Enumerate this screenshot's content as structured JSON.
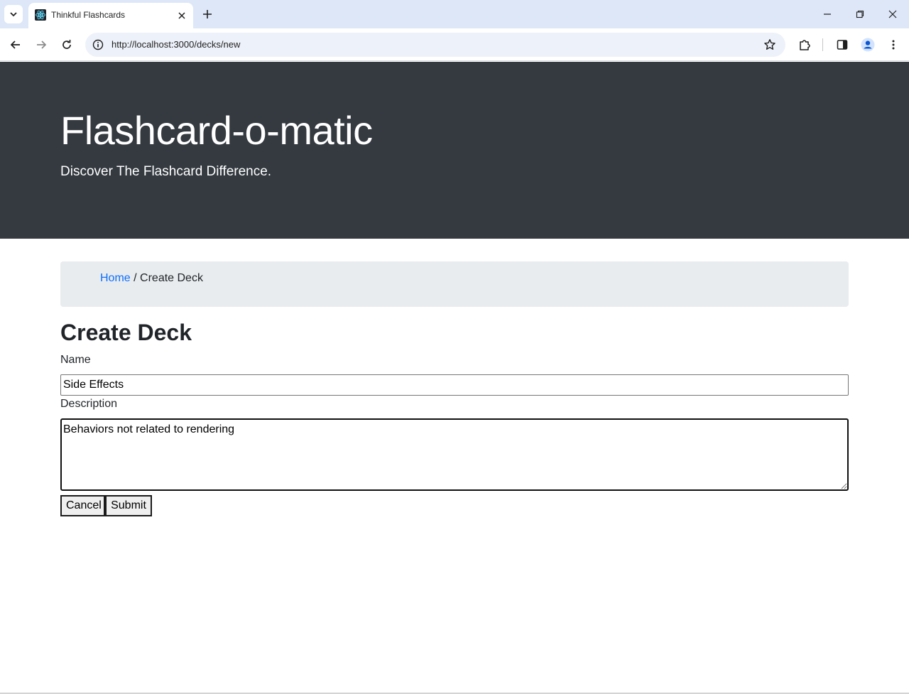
{
  "browser": {
    "tab_title": "Thinkful Flashcards",
    "url": "http://localhost:3000/decks/new"
  },
  "header": {
    "title": "Flashcard-o-matic",
    "lead": "Discover The Flashcard Difference."
  },
  "breadcrumb": {
    "home_label": "Home",
    "separator": "/",
    "current_label": "Create Deck"
  },
  "form": {
    "heading": "Create Deck",
    "name_label": "Name",
    "name_value": "Side Effects",
    "description_label": "Description",
    "description_value": "Behaviors not related to rendering",
    "cancel_label": "Cancel",
    "submit_label": "Submit"
  },
  "colors": {
    "jumbotron_bg": "#343a40",
    "breadcrumb_bg": "#e9ecef",
    "link": "#0d6efd",
    "tabstrip_bg": "#dde7f7",
    "profile_accent": "#0b57d0"
  },
  "icons": {
    "tab_search": "chevron-down-icon",
    "favicon": "react-atom-icon",
    "tab_close": "close-icon",
    "new_tab": "plus-icon",
    "back": "arrow-left-icon",
    "forward": "arrow-right-icon",
    "reload": "reload-icon",
    "site_info": "info-icon",
    "bookmark": "star-icon",
    "extensions": "puzzle-icon",
    "side_panel": "side-panel-icon",
    "profile": "profile-icon",
    "menu": "kebab-menu-icon",
    "minimize": "minimize-icon",
    "maximize": "restore-icon",
    "window_close": "close-icon"
  }
}
